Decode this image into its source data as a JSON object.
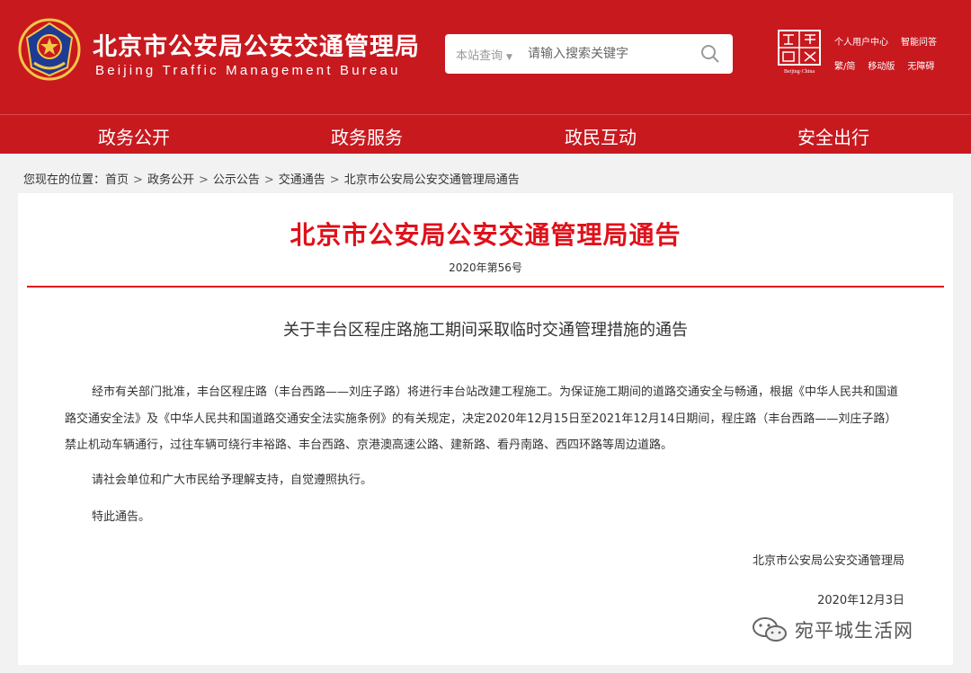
{
  "header": {
    "title": "北京市公安局公安交通管理局",
    "subtitle": "Beijing Traffic Management Bureau",
    "brand_color": "#c8191f",
    "search": {
      "scope": "本站查询",
      "placeholder": "请输入搜索关键字"
    },
    "capital_logo_text": "Beijing·China",
    "top_links": {
      "row1": [
        "个人用户中心",
        "智能问答"
      ],
      "row2": [
        "繁/简",
        "移动版",
        "无障碍"
      ]
    }
  },
  "nav": {
    "items": [
      "政务公开",
      "政务服务",
      "政民互动",
      "安全出行"
    ]
  },
  "breadcrumb": {
    "prefix": "您现在的位置：",
    "items": [
      "首页",
      "政务公开",
      "公示公告",
      "交通通告",
      "北京市公安局公安交通管理局通告"
    ],
    "separator": ">"
  },
  "notice": {
    "title": "北京市公安局公安交通管理局通告",
    "number": "2020年第56号",
    "accent_color": "#e0101a",
    "heading": "关于丰台区程庄路施工期间采取临时交通管理措施的通告",
    "paragraphs": [
      "经市有关部门批准，丰台区程庄路（丰台西路——刘庄子路）将进行丰台站改建工程施工。为保证施工期间的道路交通安全与畅通，根据《中华人民共和国道路交通安全法》及《中华人民共和国道路交通安全法实施条例》的有关规定，决定2020年12月15日至2021年12月14日期间，程庄路（丰台西路——刘庄子路）禁止机动车辆通行，过往车辆可绕行丰裕路、丰台西路、京港澳高速公路、建新路、看丹南路、西四环路等周边道路。",
      "请社会单位和广大市民给予理解支持，自觉遵照执行。",
      "特此通告。"
    ],
    "signature": "北京市公安局公安交通管理局",
    "date": "2020年12月3日"
  },
  "watermark": {
    "text": "宛平城生活网"
  }
}
